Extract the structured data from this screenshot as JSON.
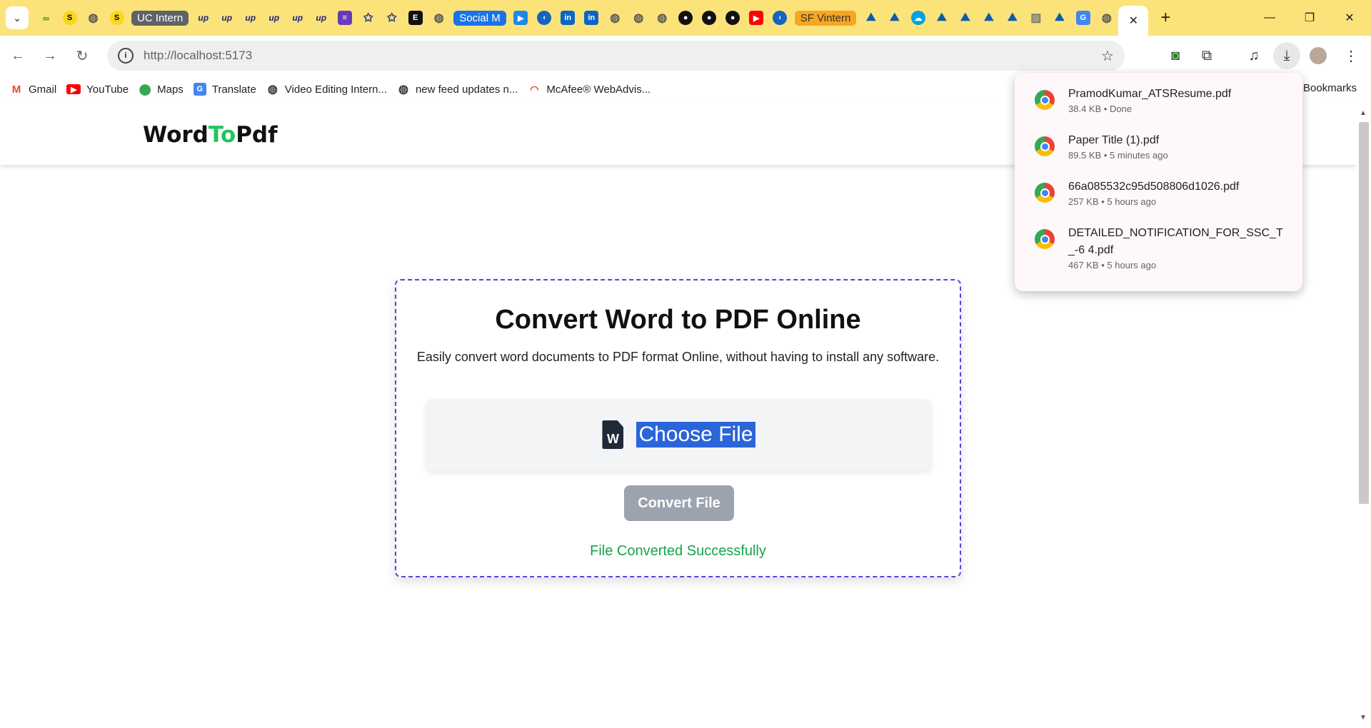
{
  "tabstrip": {
    "chips": [
      "UC Intern",
      "Social M",
      "SF Vintern"
    ],
    "pinned_texts": [
      "S",
      "S",
      "up",
      "up",
      "up",
      "up",
      "up",
      "up",
      "E"
    ],
    "new_tab": "+",
    "close_tab": "✕"
  },
  "toolbar": {
    "url": "http://localhost:5173"
  },
  "bookmarks": {
    "items": [
      "Gmail",
      "YouTube",
      "Maps",
      "Translate",
      "Video Editing Intern...",
      "new feed updates n...",
      "McAfee® WebAdvis..."
    ],
    "all": "Bookmarks"
  },
  "site": {
    "logo_part1": "Word",
    "logo_part2": "To",
    "logo_part3": "Pdf",
    "title": "Convert Word to PDF Online",
    "description": "Easily convert word documents to PDF format Online, without having to install any software.",
    "choose_label": "Choose File",
    "convert_label": "Convert File",
    "status": "File Converted Successfully",
    "doc_icon_letter": "W"
  },
  "downloads": [
    {
      "name": "PramodKumar_ATSResume.pdf",
      "meta": "38.4 KB • Done"
    },
    {
      "name": "Paper Title (1).pdf",
      "meta": "89.5 KB • 5 minutes ago"
    },
    {
      "name": "66a085532c95d508806d1026.pdf",
      "meta": "257 KB • 5 hours ago"
    },
    {
      "name": "DETAILED_NOTIFICATION_FOR_SSC_T_-6 4.pdf",
      "meta": "467 KB • 5 hours ago"
    }
  ],
  "colors": {
    "tabstrip_bg": "#fbe37a",
    "logo_accent": "#22c55e",
    "card_border": "#4f46e5",
    "status_green": "#16a34a",
    "convert_disabled": "#9ca3af"
  }
}
